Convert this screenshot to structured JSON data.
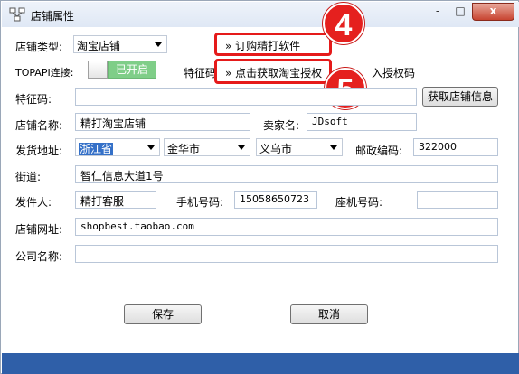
{
  "window": {
    "title": "店铺属性",
    "close_label": "x",
    "minimize_label": "-",
    "maximize_label": "□"
  },
  "form": {
    "shop_type_label": "店铺类型:",
    "shop_type_value": "淘宝店铺",
    "topapi_label": "TOPAPI连接:",
    "topapi_toggle_text": "已开启",
    "feature_label_short": "特征码",
    "import_auth_code": "入授权码",
    "feature_code_label": "特征码:",
    "feature_code_value": "",
    "get_shop_info_btn": "获取店铺信息",
    "shop_name_label": "店铺名称:",
    "shop_name_value": "精打淘宝店铺",
    "seller_name_label": "卖家名:",
    "seller_name_value": "JDsoft",
    "ship_address_label": "发货地址:",
    "province": "浙江省",
    "city": "金华市",
    "district": "义乌市",
    "zip_label": "邮政编码:",
    "zip_value": "322000",
    "street_label": "街道:",
    "street_value": "智仁信息大道1号",
    "sender_label": "发件人:",
    "sender_value": "精打客服",
    "mobile_label": "手机号码:",
    "mobile_value": "15058650723",
    "landline_label": "座机号码:",
    "landline_value": "",
    "url_label": "店铺网址:",
    "url_value": "shopbest.taobao.com",
    "company_label": "公司名称:",
    "company_value": "",
    "save_btn": "保存",
    "cancel_btn": "取消"
  },
  "links": {
    "order_software": "订购精打软件",
    "get_taobao_auth": "点击获取淘宝授权",
    "arrow_glyph": "»"
  },
  "annotations": {
    "badge_4": "4",
    "badge_5": "5",
    "color": "#e5201e"
  },
  "colors": {
    "toggle_on": "#7fce88",
    "footer": "#2f5fa8",
    "highlight": "#e51a1a"
  }
}
